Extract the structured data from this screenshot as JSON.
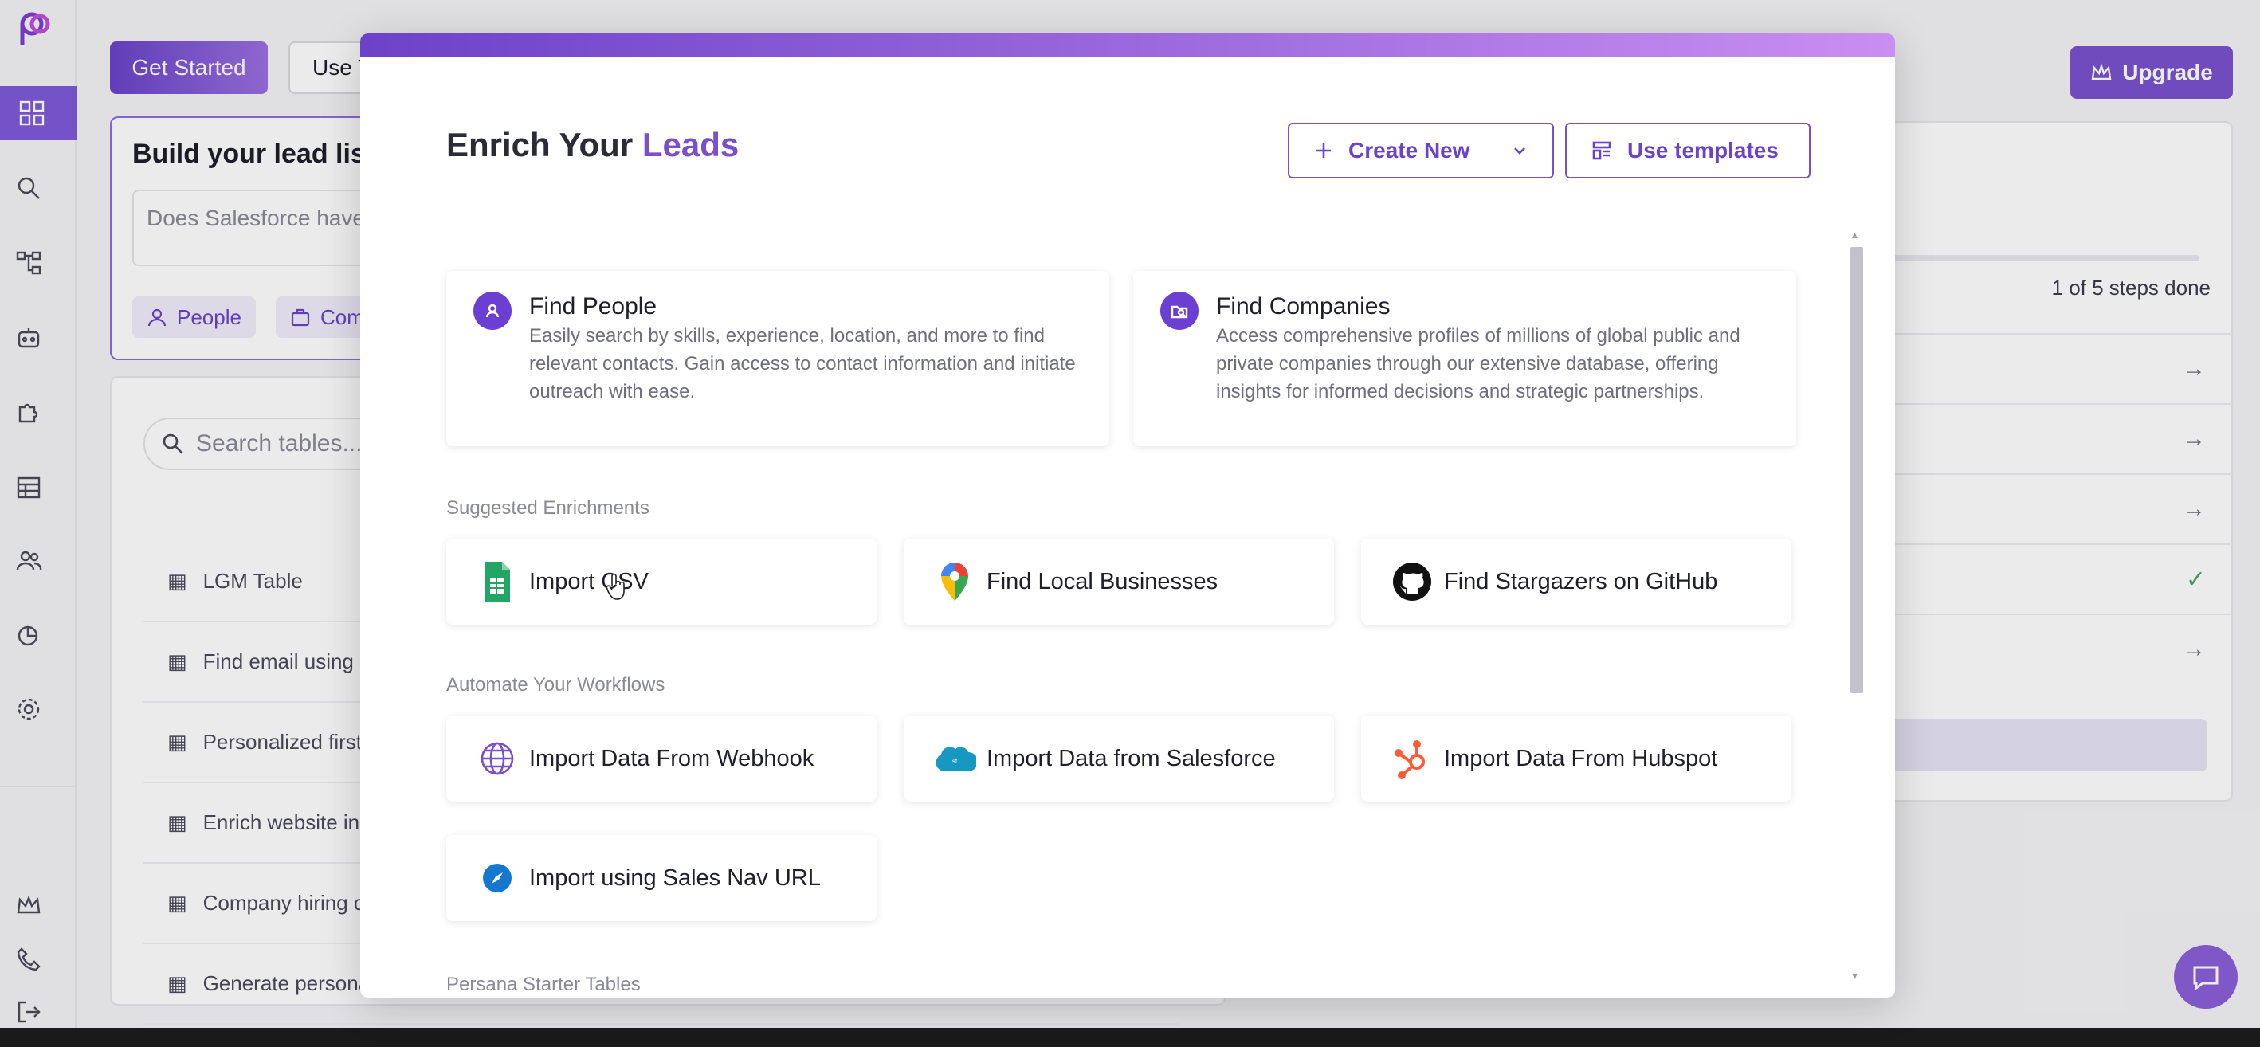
{
  "background": {
    "get_started": "Get Started",
    "use_button": "Use T",
    "lead_title": "Build your lead list",
    "lead_input_placeholder": "Does Salesforce have",
    "chip_people": "People",
    "chip_companies": "Com",
    "search_placeholder": "Search tables...",
    "tables": [
      "LGM Table",
      "Find email using N",
      "Personalized first l",
      "Enrich website ins",
      "Company hiring ch",
      "Generate personal"
    ],
    "upgrade": "Upgrade",
    "steps_done": "1 of 5 steps done"
  },
  "modal": {
    "title_prefix": "Enrich Your",
    "title_accent": "Leads",
    "create_new": "Create New",
    "use_templates": "Use templates",
    "find_people": {
      "title": "Find People",
      "desc": "Easily search by skills, experience, location, and more to find relevant contacts. Gain access to contact information and initiate outreach with ease."
    },
    "find_companies": {
      "title": "Find Companies",
      "desc": "Access comprehensive profiles of millions of global public and private companies through our extensive database, offering insights for informed decisions and strategic partnerships."
    },
    "suggested_label": "Suggested Enrichments",
    "import_csv": "Import CSV",
    "find_local": "Find Local Businesses",
    "stargazers": "Find Stargazers on GitHub",
    "automate_label": "Automate Your Workflows",
    "webhook": "Import Data From Webhook",
    "salesforce": "Import Data from Salesforce",
    "hubspot": "Import Data From Hubspot",
    "salesnav": "Import using Sales Nav URL",
    "starter_label": "Persana Starter Tables"
  },
  "icons": {
    "logo": "persana-logo-icon",
    "people": "user-icon",
    "companies": "building-icon",
    "csv": "google-sheets-icon",
    "maps": "google-maps-pin-icon",
    "github": "github-icon",
    "webhook": "globe-icon",
    "salesforce": "salesforce-cloud-icon",
    "hubspot": "hubspot-icon",
    "salesnav": "compass-icon"
  },
  "colors": {
    "accent": "#7b4fcc",
    "modal_bar_start": "#6c42c8",
    "modal_bar_end": "#c98ef0",
    "success": "#3fa856"
  }
}
